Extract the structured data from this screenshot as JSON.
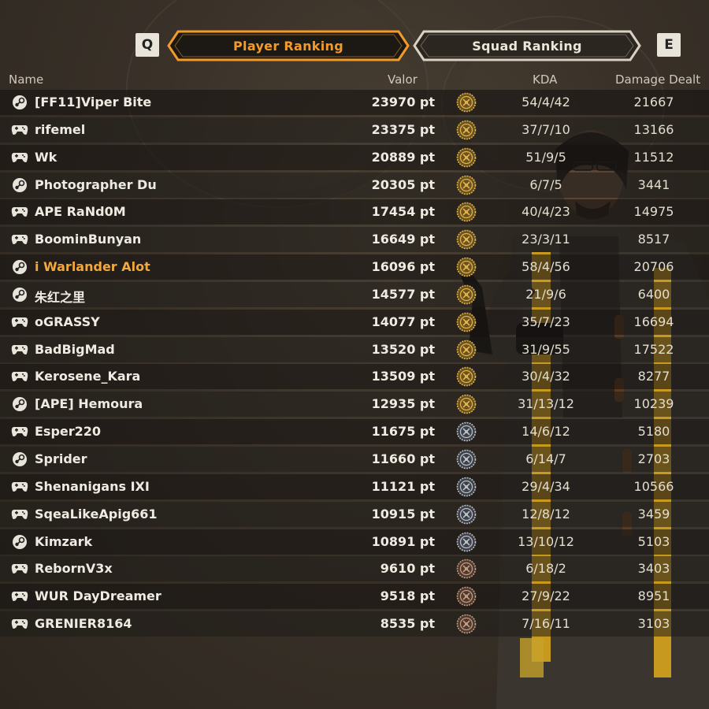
{
  "tabs": {
    "prev_key": "Q",
    "next_key": "E",
    "player_ranking": "Player Ranking",
    "squad_ranking": "Squad Ranking",
    "active": "Player Ranking"
  },
  "table": {
    "headers": {
      "name": "Name",
      "valor": "Valor",
      "kda": "KDA",
      "damage": "Damage Dealt"
    },
    "rows": [
      {
        "platform": "steam-icon",
        "name": "[FF11]Viper Bite",
        "valor": "23970 pt",
        "rank": "gold",
        "kda": "54/4/42",
        "damage": "21667"
      },
      {
        "platform": "gamepad-icon",
        "name": "rifemel",
        "valor": "23375 pt",
        "rank": "gold",
        "kda": "37/7/10",
        "damage": "13166"
      },
      {
        "platform": "gamepad-icon",
        "name": "Wk",
        "valor": "20889 pt",
        "rank": "gold",
        "kda": "51/9/5",
        "damage": "11512"
      },
      {
        "platform": "steam-icon",
        "name": "Photographer Du",
        "valor": "20305 pt",
        "rank": "gold",
        "kda": "6/7/5",
        "damage": "3441"
      },
      {
        "platform": "gamepad-icon",
        "name": "APE RaNd0M",
        "valor": "17454 pt",
        "rank": "gold",
        "kda": "40/4/23",
        "damage": "14975"
      },
      {
        "platform": "gamepad-icon",
        "name": "BoominBunyan",
        "valor": "16649 pt",
        "rank": "gold",
        "kda": "23/3/11",
        "damage": "8517"
      },
      {
        "platform": "steam-icon",
        "name": "i Warlander Alot",
        "valor": "16096 pt",
        "rank": "gold",
        "kda": "58/4/56",
        "damage": "20706",
        "highlight": true
      },
      {
        "platform": "steam-icon",
        "name": "朱红之里",
        "valor": "14577 pt",
        "rank": "gold",
        "kda": "21/9/6",
        "damage": "6400"
      },
      {
        "platform": "gamepad-icon",
        "name": "oGRASSY",
        "valor": "14077 pt",
        "rank": "gold",
        "kda": "35/7/23",
        "damage": "16694"
      },
      {
        "platform": "gamepad-icon",
        "name": "BadBigMad",
        "valor": "13520 pt",
        "rank": "gold",
        "kda": "31/9/55",
        "damage": "17522"
      },
      {
        "platform": "gamepad-icon",
        "name": "Kerosene_Kara",
        "valor": "13509 pt",
        "rank": "gold",
        "kda": "30/4/32",
        "damage": "8277"
      },
      {
        "platform": "steam-icon",
        "name": "[APE] Hemoura",
        "valor": "12935 pt",
        "rank": "gold",
        "kda": "31/13/12",
        "damage": "10239"
      },
      {
        "platform": "gamepad-icon",
        "name": "Esper220",
        "valor": "11675 pt",
        "rank": "silver",
        "kda": "14/6/12",
        "damage": "5180"
      },
      {
        "platform": "steam-icon",
        "name": "Sprider",
        "valor": "11660 pt",
        "rank": "silver",
        "kda": "6/14/7",
        "damage": "2703"
      },
      {
        "platform": "gamepad-icon",
        "name": "Shenanigans IXI",
        "valor": "11121 pt",
        "rank": "silver",
        "kda": "29/4/34",
        "damage": "10566"
      },
      {
        "platform": "gamepad-icon",
        "name": "SqeaLikeApig661",
        "valor": "10915 pt",
        "rank": "silver",
        "kda": "12/8/12",
        "damage": "3459"
      },
      {
        "platform": "steam-icon",
        "name": "Kimzark",
        "valor": "10891 pt",
        "rank": "silver",
        "kda": "13/10/12",
        "damage": "5103"
      },
      {
        "platform": "gamepad-icon",
        "name": "RebornV3x",
        "valor": "9610 pt",
        "rank": "bronze",
        "kda": "6/18/2",
        "damage": "3403"
      },
      {
        "platform": "gamepad-icon",
        "name": "WUR DayDreamer",
        "valor": "9518 pt",
        "rank": "bronze",
        "kda": "27/9/22",
        "damage": "8951"
      },
      {
        "platform": "gamepad-icon",
        "name": "GRENIER8164",
        "valor": "8535 pt",
        "rank": "bronze",
        "kda": "7/16/11",
        "damage": "3103"
      }
    ]
  },
  "colors": {
    "accent": "#f29b2a",
    "highlight_name": "#f2a83a",
    "gold_rank": "#e2b24a",
    "silver_rank": "#b9bfc8",
    "bronze_rank": "#c79a7e"
  }
}
